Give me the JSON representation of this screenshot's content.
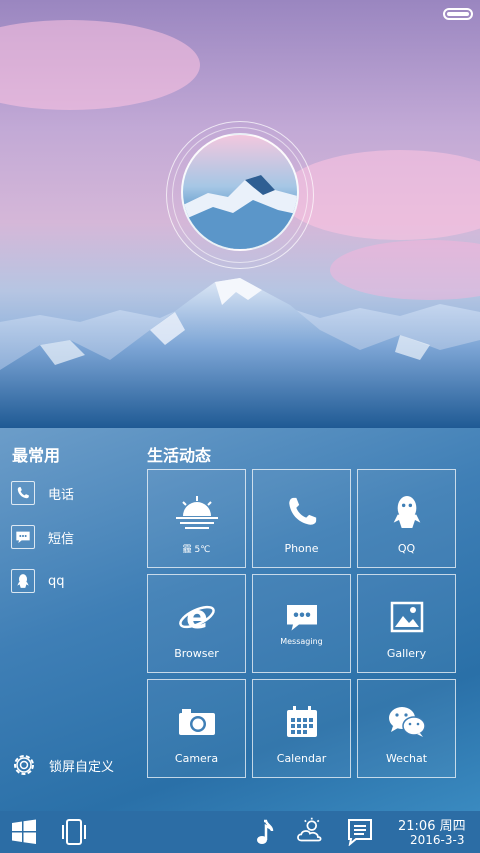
{
  "status_bar": {
    "battery_icon": "battery-full-icon"
  },
  "hero": {
    "avatar_icon": "mountain-avatar"
  },
  "favorites": {
    "title": "最常用",
    "items": [
      {
        "label": "电话",
        "icon": "phone-icon"
      },
      {
        "label": "短信",
        "icon": "sms-icon"
      },
      {
        "label": "qq",
        "icon": "qq-icon"
      }
    ],
    "settings_label": "锁屏自定义"
  },
  "life": {
    "title": "生活动态",
    "tiles": [
      {
        "label": "霾 5℃",
        "icon": "weather-sunrise-icon"
      },
      {
        "label": "Phone",
        "icon": "phone-icon"
      },
      {
        "label": "QQ",
        "icon": "qq-icon"
      },
      {
        "label": "Browser",
        "icon": "browser-icon"
      },
      {
        "label": "Messaging",
        "icon": "messaging-icon"
      },
      {
        "label": "Gallery",
        "icon": "gallery-icon"
      },
      {
        "label": "Camera",
        "icon": "camera-icon"
      },
      {
        "label": "Calendar",
        "icon": "calendar-icon"
      },
      {
        "label": "Wechat",
        "icon": "wechat-icon"
      }
    ]
  },
  "taskbar": {
    "time": "21:06 周四",
    "date": "2016-3-3",
    "icons": [
      "windows-icon",
      "phone-frame-icon",
      "music-icon",
      "weather-icon",
      "notes-icon"
    ]
  },
  "colors": {
    "panel": "#3f7fb6",
    "taskbar": "#2c6da5",
    "accent_pink": "#f2c7de"
  }
}
